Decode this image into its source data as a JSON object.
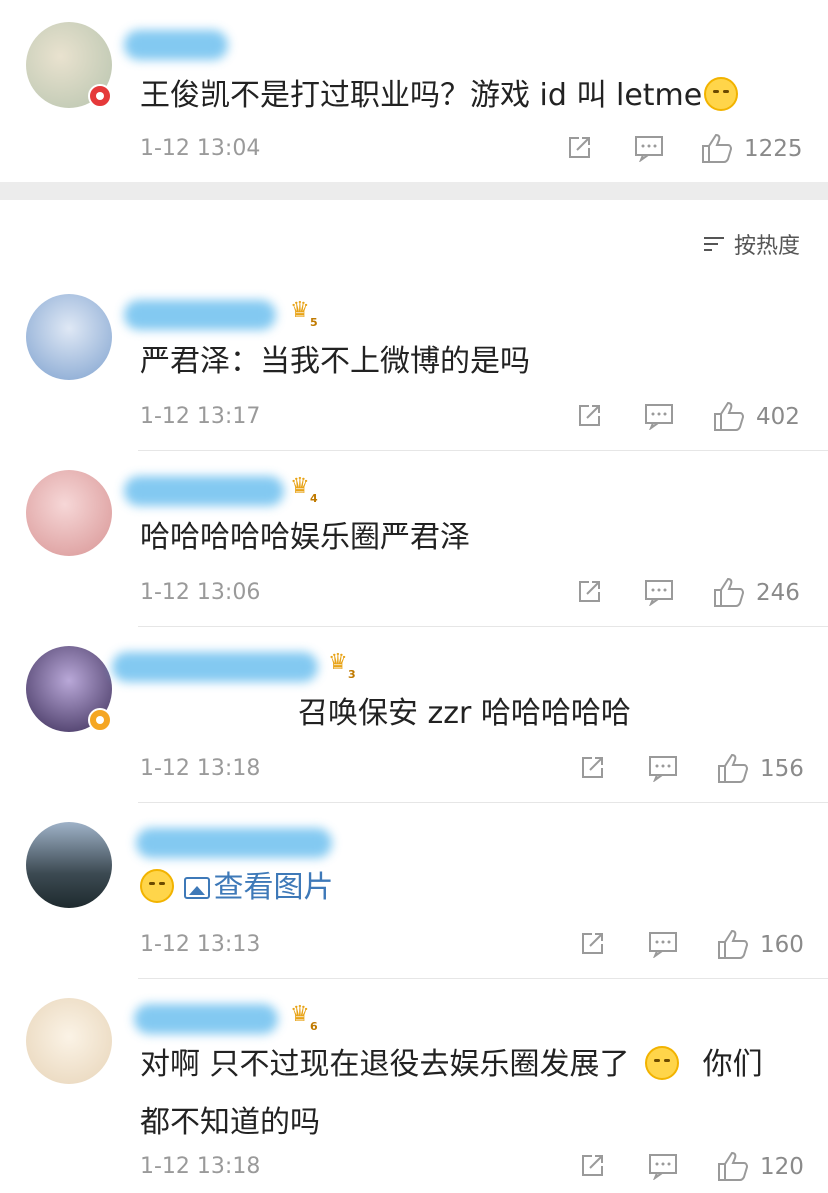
{
  "sort": {
    "label": "按热度",
    "icon": "sort-icon"
  },
  "comments": [
    {
      "text": "王俊凯不是打过职业吗？游戏 id 叫 letme",
      "time": "1-12 13:04",
      "likes": "1225",
      "badge": "red"
    },
    {
      "text": "严君泽：当我不上微博的是吗",
      "time": "1-12 13:17",
      "likes": "402",
      "vip": "5"
    },
    {
      "text": "哈哈哈哈哈娱乐圈严君泽",
      "time": "1-12 13:06",
      "likes": "246",
      "vip": "4"
    },
    {
      "text": "召唤保安 zzr 哈哈哈哈哈",
      "time": "1-12 13:18",
      "likes": "156",
      "vip": "3",
      "badge": "gold"
    },
    {
      "text": "查看图片",
      "time": "1-12 13:13",
      "likes": "160"
    },
    {
      "text_line1": "对啊 只不过现在退役去娱乐圈发展了",
      "text_line1b": "你们",
      "text_line2": "都不知道的吗",
      "time": "1-12 13:18",
      "likes": "120",
      "vip": "6"
    }
  ],
  "colors": {
    "name_blur": "#6ec0ef",
    "link": "#3e79b8",
    "meta": "#9a9a9a"
  }
}
